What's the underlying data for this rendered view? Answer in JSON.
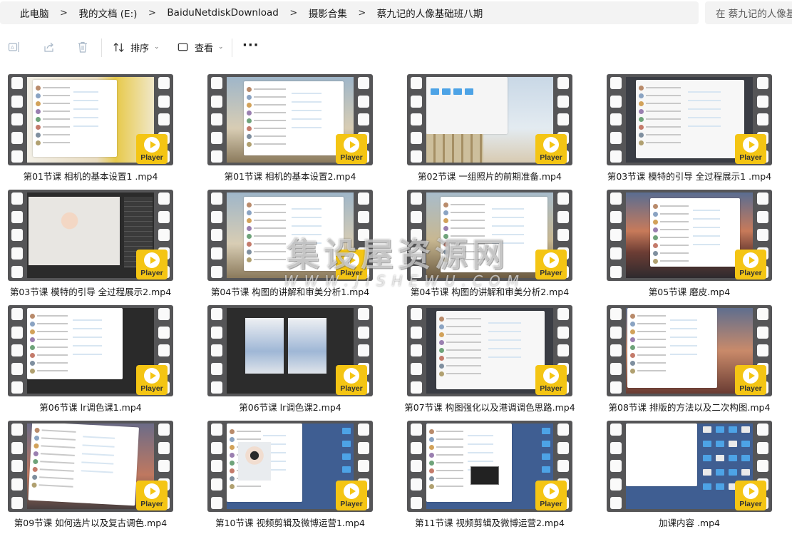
{
  "breadcrumb": [
    {
      "label": "此电脑"
    },
    {
      "label": "我的文档 (E:)"
    },
    {
      "label": "BaiduNetdiskDownload"
    },
    {
      "label": "摄影合集"
    },
    {
      "label": "蔡九记的人像基础班八期"
    }
  ],
  "breadcrumb_separator": ">",
  "search": {
    "placeholder": "在 蔡九记的人像基础班八期 中搜索"
  },
  "toolbar": {
    "sort_label": "排序",
    "view_label": "查看",
    "more_label": "···"
  },
  "files": [
    {
      "name": "第01节课 相机的基本设置1 .mp4",
      "badge": "Player",
      "thumb": "chat-portrait-yellow"
    },
    {
      "name": "第01节课 相机的基本设置2.mp4",
      "badge": "Player",
      "thumb": "chat-building"
    },
    {
      "name": "第02节课 一组照片的前期准备.mp4",
      "badge": "Player",
      "thumb": "folders-sky"
    },
    {
      "name": "第03节课 模特的引导 全过程展示1 .mp4",
      "badge": "Player",
      "thumb": "chat-dark"
    },
    {
      "name": "第03节课 模特的引导 全过程展示2.mp4",
      "badge": "Player",
      "thumb": "lightroom-portrait"
    },
    {
      "name": "第04节课 构图的讲解和审美分析1.mp4",
      "badge": "Player",
      "thumb": "chat-building"
    },
    {
      "name": "第04节课 构图的讲解和审美分析2.mp4",
      "badge": "Player",
      "thumb": "chat-building-dark"
    },
    {
      "name": "第05节课 磨皮.mp4",
      "badge": "Player",
      "thumb": "chat-mountain"
    },
    {
      "name": "第06节课 lr调色课1.mp4",
      "badge": "Player",
      "thumb": "chat-lightroom"
    },
    {
      "name": "第06节课 lr调色课2.mp4",
      "badge": "Player",
      "thumb": "lightroom-compare"
    },
    {
      "name": "第07节课 构图强化以及港调调色思路.mp4",
      "badge": "Player",
      "thumb": "chat-dark"
    },
    {
      "name": "第08节课 排版的方法以及二次构图.mp4",
      "badge": "Player",
      "thumb": "chat-mountain-red"
    },
    {
      "name": "第09节课 如何选片以及复古调色.mp4",
      "badge": "Player",
      "thumb": "chat-tilted"
    },
    {
      "name": "第10节课 视频剪辑及微博运营1.mp4",
      "badge": "Player",
      "thumb": "blue-desktop-portrait"
    },
    {
      "name": "第11节课 视频剪辑及微博运营2.mp4",
      "badge": "Player",
      "thumb": "blue-desktop-video"
    },
    {
      "name": "加课内容 .mp4",
      "badge": "Player",
      "thumb": "blue-desktop-window"
    }
  ],
  "watermark": {
    "title": "集设屋资源网",
    "url": "WWW.JISHEWU.COM"
  },
  "colors": {
    "badge": "#f4c514",
    "film": "#555557",
    "addressbar": "#f3f3f3"
  }
}
